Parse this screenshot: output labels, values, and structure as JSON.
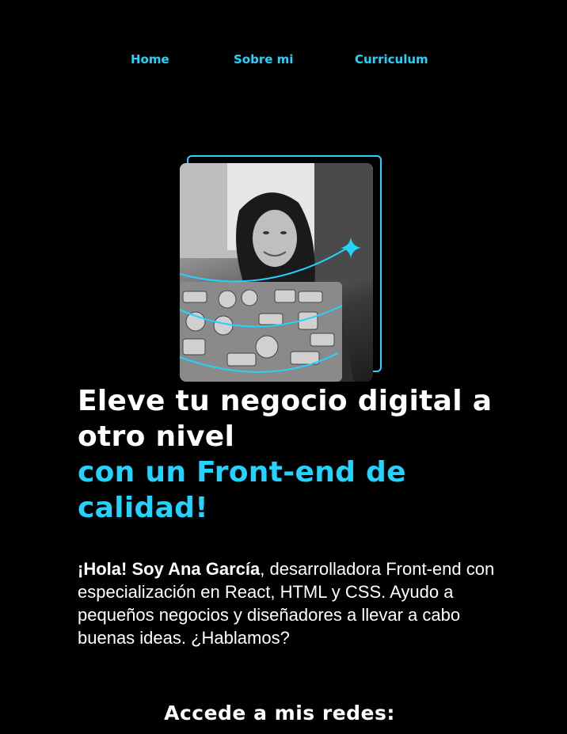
{
  "nav": {
    "items": [
      {
        "label": "Home"
      },
      {
        "label": "Sobre mi"
      },
      {
        "label": "Curriculum"
      }
    ]
  },
  "hero": {
    "headline_white": "Eleve tu negocio digital a otro nivel",
    "headline_cyan": "con un Front-end de calidad!",
    "intro_bold": "¡Hola! Soy Ana García",
    "intro_rest": ", desarrolladora Front-end con especialización en React, HTML y CSS. Ayudo a pequeños negocios y diseñadores a llevar a cabo buenas ideas. ¿Hablamos?"
  },
  "social": {
    "title": "Accede a mis redes:"
  },
  "colors": {
    "background": "#000000",
    "accent": "#22d4fd",
    "text": "#ffffff"
  },
  "icons": [
    "sparkle-icon"
  ]
}
